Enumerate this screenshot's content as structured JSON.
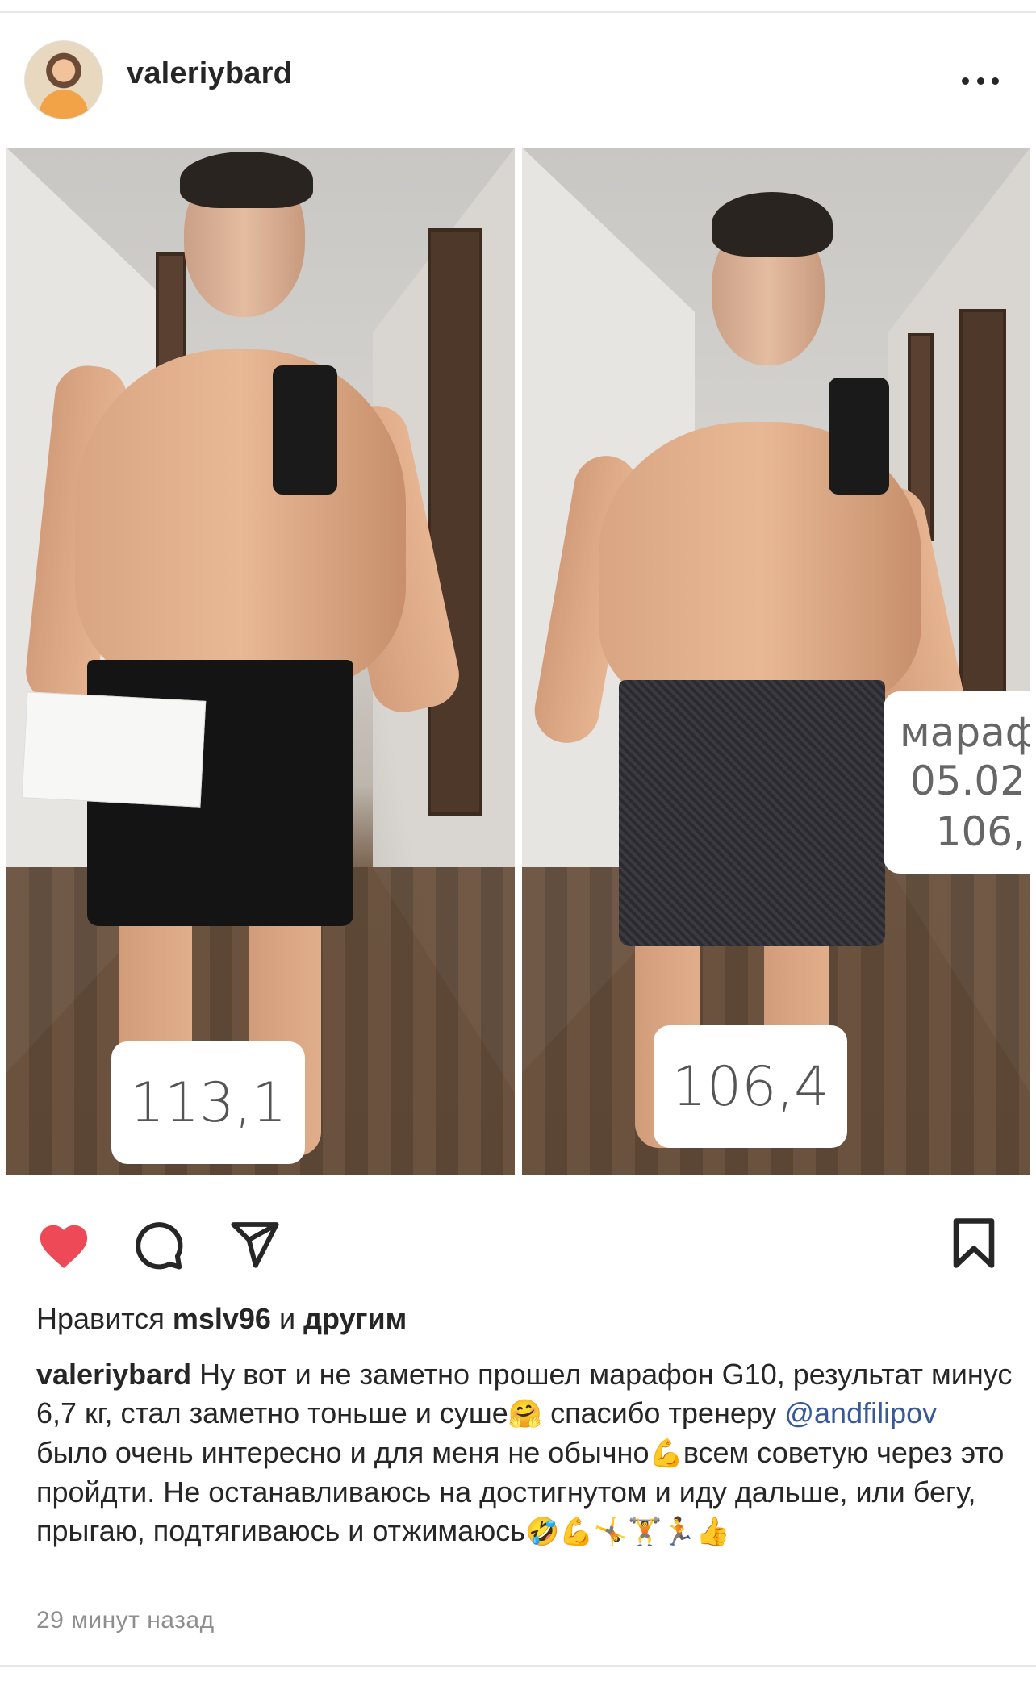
{
  "post": {
    "username": "valeriybard",
    "more_label": "•••"
  },
  "photos": {
    "left": {
      "weight_label": "113,1"
    },
    "right": {
      "weight_label": "106,4",
      "corner_note": [
        "марафон",
        "05.02",
        "106,"
      ]
    }
  },
  "actions": {
    "like_icon": "heart-filled-icon",
    "comment_icon": "comment-icon",
    "share_icon": "send-icon",
    "save_icon": "bookmark-icon",
    "like_color": "#ed4956"
  },
  "likes": {
    "prefix": "Нравится ",
    "user": "mslv96",
    "middle": " и ",
    "others": "другим"
  },
  "caption": {
    "username": "valeriybard",
    "part1": " Ну вот и не заметно прошел марафон G10, результат минус 6,7 кг, стал заметно тоньше и суше",
    "emoji1": "🤗",
    "part2": " спасибо тренеру ",
    "mention": "@andfilipov",
    "part3": "  было очень интересно и для меня не обычно",
    "emoji2": "💪",
    "part4": "всем советую через это пройдти. Не останавливаюсь на достигнутом  и иду дальше, или бегу, прыгаю, подтягиваюсь и отжимаюсь",
    "emoji_tail": "🤣💪🤸🏋🏃👍"
  },
  "timestamp": "29 минут назад"
}
